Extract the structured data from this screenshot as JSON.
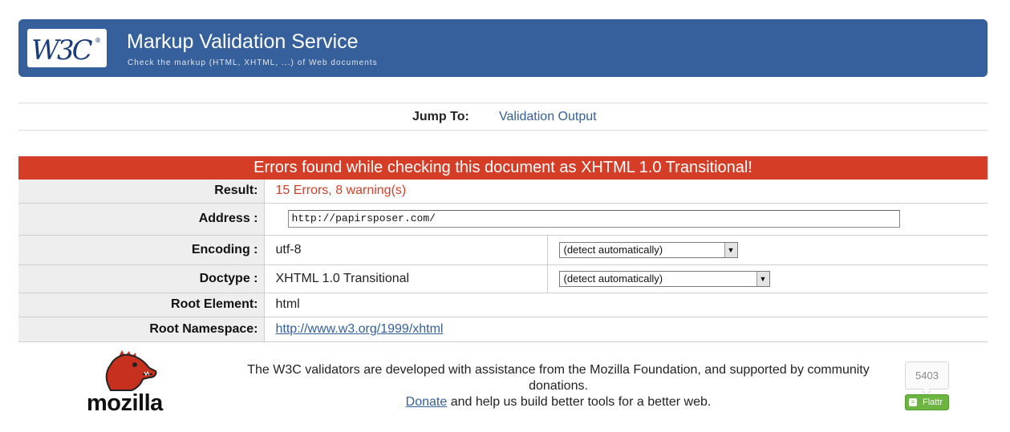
{
  "banner": {
    "logo_alt": "W3C",
    "title": "Markup Validation Service",
    "subtitle": "Check the markup (HTML, XHTML, ...) of Web documents"
  },
  "jump": {
    "label": "Jump To:",
    "link": "Validation Output"
  },
  "error_heading": "Errors found while checking this document as XHTML 1.0 Transitional!",
  "results": {
    "result_label": "Result:",
    "result_value": "15 Errors, 8 warning(s)",
    "address_label": "Address :",
    "address_value": "http://papirsposer.com/",
    "encoding_label": "Encoding :",
    "encoding_value": "utf-8",
    "encoding_select": "(detect automatically)",
    "doctype_label": "Doctype :",
    "doctype_value": "XHTML 1.0 Transitional",
    "doctype_select": "(detect automatically)",
    "root_element_label": "Root Element:",
    "root_element_value": "html",
    "root_namespace_label": "Root Namespace:",
    "root_namespace_value": "http://www.w3.org/1999/xhtml"
  },
  "footer": {
    "mozilla_word": "mozilla",
    "line1": "The W3C validators are developed with assistance from the Mozilla Foundation, and supported by community donations.",
    "donate_link": "Donate",
    "line2_rest": " and help us build better tools for a better web.",
    "flattr_count": "5403",
    "flattr_label": "Flattr"
  },
  "colors": {
    "banner_blue": "#35609b",
    "error_red": "#d63d27",
    "flattr_green": "#6bb540"
  },
  "icons": [
    "w3c-logo-icon",
    "mozilla-dino-icon",
    "flattr-icon",
    "dropdown-arrow-icon"
  ]
}
